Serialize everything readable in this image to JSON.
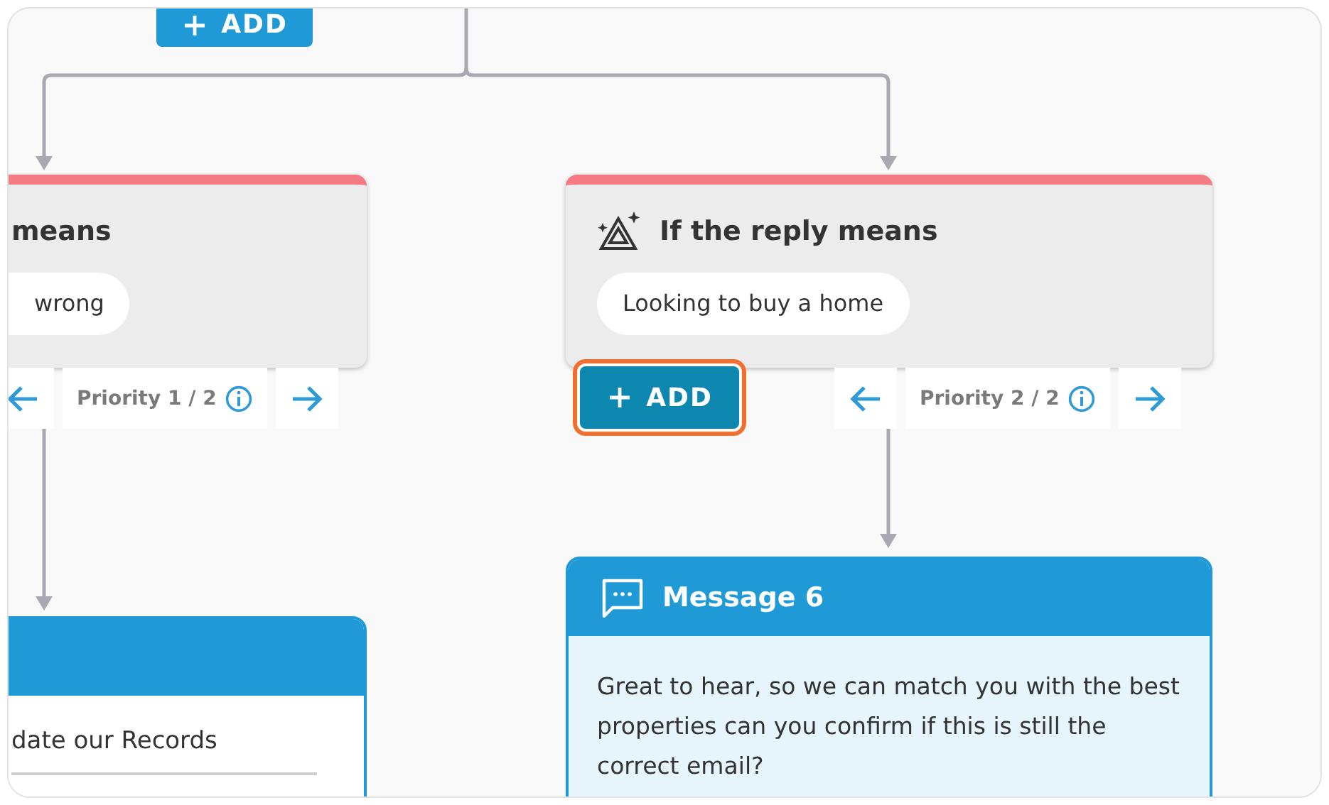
{
  "top_add_button": {
    "label": "ADD"
  },
  "conditions": [
    {
      "title": "means",
      "phrase": "wrong",
      "priority": "Priority 1 / 2"
    },
    {
      "title": "If the reply means",
      "phrase": "Looking to buy a home",
      "priority": "Priority 2 / 2",
      "add_button": {
        "label": "ADD",
        "highlighted": true
      }
    }
  ],
  "actions": [
    {
      "kind": "action",
      "text": "date our Records"
    },
    {
      "kind": "message",
      "title": "Message 6",
      "text": "Great to hear, so we can match you with the best properties can you confirm if this is still the correct email?"
    }
  ]
}
